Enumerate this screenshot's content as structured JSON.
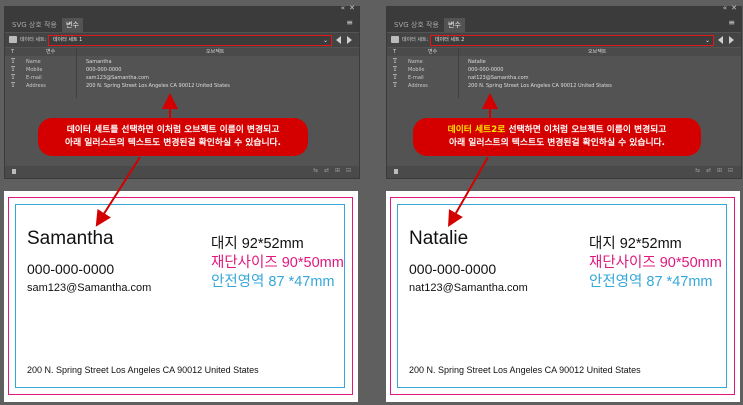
{
  "colors": {
    "highlight_red": "#d40000",
    "annotation_yellow": "#ffe600",
    "trim_magenta": "#e0187e",
    "safe_blue": "#36a7d8"
  },
  "panels": [
    {
      "tabs": [
        "SVG 상호 작용",
        "변수"
      ],
      "dataset_label": "데이터 세트:",
      "dataset_value": "데이터 세트 1",
      "columns": [
        "T",
        "변수",
        "오브젝트"
      ],
      "rows": [
        {
          "type": "T",
          "name": "Name",
          "value": "Samantha"
        },
        {
          "type": "T",
          "name": "Mobile",
          "value": "000-000-0000"
        },
        {
          "type": "T",
          "name": "E-mail",
          "value": "sam123@Samantha.com"
        },
        {
          "type": "T",
          "name": "Address",
          "value": "200 N. Spring Street Los Angeles CA 90012 United States"
        }
      ],
      "callout": {
        "line1_pre": "데이터 세트를",
        "line1_post": " 선택하면 이처럼 오브젝트 이름이 변경되고",
        "line2": "아래 일러스트의 텍스트도 변경된걸 확인하실 수 있습니다."
      }
    },
    {
      "tabs": [
        "SVG 상호 작용",
        "변수"
      ],
      "dataset_label": "데이터 세트:",
      "dataset_value": "데이터 세트 2",
      "columns": [
        "T",
        "변수",
        "오브젝트"
      ],
      "rows": [
        {
          "type": "T",
          "name": "Name",
          "value": "Natalie"
        },
        {
          "type": "T",
          "name": "Mobile",
          "value": "000-000-0000"
        },
        {
          "type": "T",
          "name": "E-mail",
          "value": "nat123@Samantha.com"
        },
        {
          "type": "T",
          "name": "Address",
          "value": "200 N. Spring Street Los Angeles CA 90012 United States"
        }
      ],
      "callout": {
        "line1_pre": "데이터 세트2로",
        "line1_post": " 선택하면 이처럼 오브젝트 이름이 변경되고",
        "line2": "아래 일러스트의 텍스트도 변경된걸 확인하실 수 있습니다."
      }
    }
  ],
  "cards": [
    {
      "name": "Samantha",
      "phone": "000-000-0000",
      "email": "sam123@Samantha.com",
      "address": "200 N. Spring Street Los Angeles CA 90012 United States",
      "spec_paper": "대지 92*52mm",
      "spec_trim": "재단사이즈 90*50mm",
      "spec_safe": "안전영역 87 *47mm"
    },
    {
      "name": "Natalie",
      "phone": "000-000-0000",
      "email": "nat123@Samantha.com",
      "address": "200 N. Spring Street Los Angeles CA 90012 United States",
      "spec_paper": "대지 92*52mm",
      "spec_trim": "재단사이즈 90*50mm",
      "spec_safe": "안전영역 87 *47mm"
    }
  ]
}
